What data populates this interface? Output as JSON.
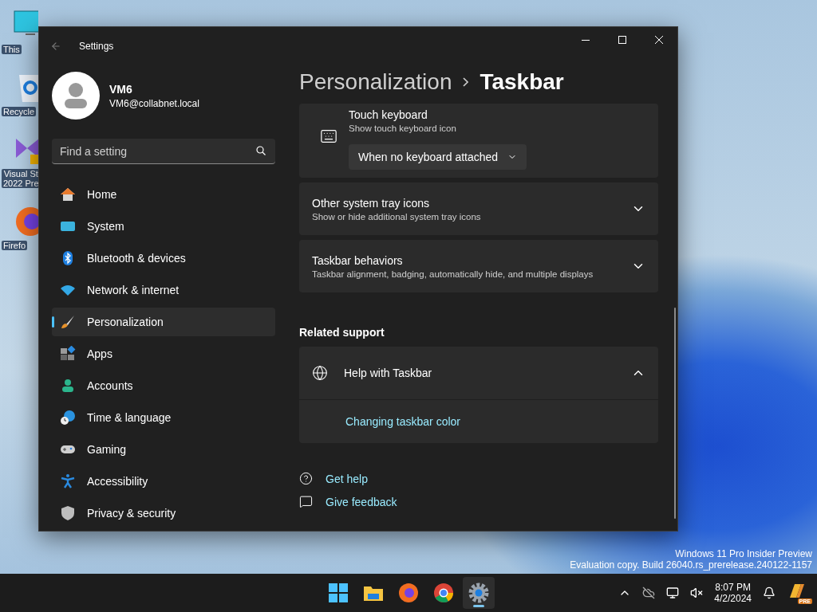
{
  "desktop_icons": [
    {
      "label": "This"
    },
    {
      "label": "Recycle"
    },
    {
      "label": "Visual St\n2022 Pre"
    },
    {
      "label": "Firefo"
    }
  ],
  "window": {
    "title": "Settings"
  },
  "account": {
    "name": "VM6",
    "email": "VM6@collabnet.local"
  },
  "search": {
    "placeholder": "Find a setting"
  },
  "nav": [
    {
      "label": "Home",
      "selected": false
    },
    {
      "label": "System",
      "selected": false
    },
    {
      "label": "Bluetooth & devices",
      "selected": false
    },
    {
      "label": "Network & internet",
      "selected": false
    },
    {
      "label": "Personalization",
      "selected": true
    },
    {
      "label": "Apps",
      "selected": false
    },
    {
      "label": "Accounts",
      "selected": false
    },
    {
      "label": "Time & language",
      "selected": false
    },
    {
      "label": "Gaming",
      "selected": false
    },
    {
      "label": "Accessibility",
      "selected": false
    },
    {
      "label": "Privacy & security",
      "selected": false
    }
  ],
  "breadcrumb": [
    "Personalization",
    "Taskbar"
  ],
  "settings": [
    {
      "kind": "dropdown",
      "title": "Touch keyboard",
      "description": "Show touch keyboard icon",
      "value": "When no keyboard attached"
    },
    {
      "kind": "expander",
      "title": "Other system tray icons",
      "description": "Show or hide additional system tray icons",
      "expanded": false
    },
    {
      "kind": "expander",
      "title": "Taskbar behaviors",
      "description": "Taskbar alignment, badging, automatically hide, and multiple displays",
      "expanded": false
    }
  ],
  "related_support": {
    "heading": "Related support",
    "items": [
      {
        "title": "Help with Taskbar",
        "expanded": true,
        "links": [
          "Changing taskbar color"
        ]
      }
    ]
  },
  "footer_links": [
    "Get help",
    "Give feedback"
  ],
  "watermark": [
    "Windows 11 Pro Insider Preview",
    "Evaluation copy. Build 26040.rs_prerelease.240122-1157"
  ],
  "taskbar": {
    "apps": [
      {
        "selected": false
      },
      {
        "selected": false
      },
      {
        "selected": false
      },
      {
        "selected": false
      },
      {
        "selected": true
      }
    ],
    "time": "8:07 PM",
    "date": "4/2/2024",
    "badge": "PRE"
  }
}
